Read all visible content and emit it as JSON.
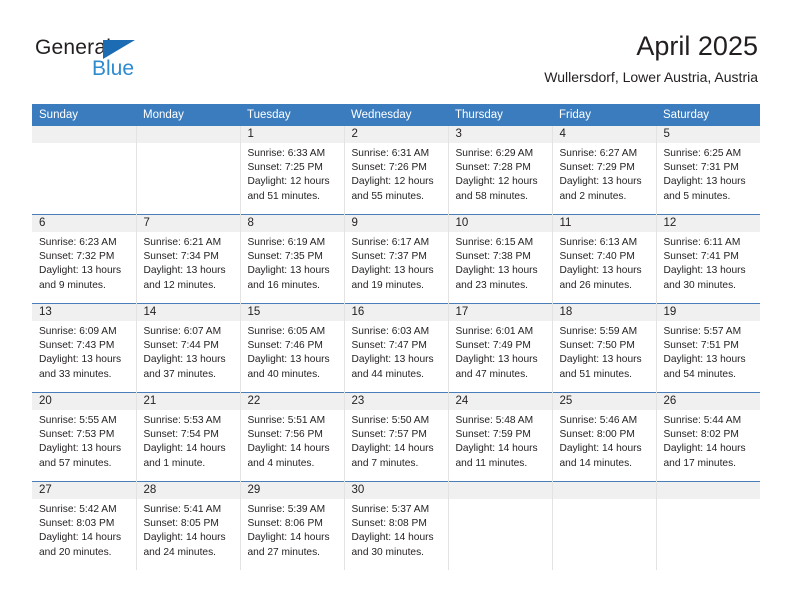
{
  "brand": {
    "name_part1": "General",
    "name_part2": "Blue",
    "triangle_icon": "triangle-icon"
  },
  "header": {
    "title": "April 2025",
    "subtitle": "Wullersdorf, Lower Austria, Austria"
  },
  "colors": {
    "header_blue": "#3b7cbe",
    "row_separator_blue": "#4a7ebb",
    "daynum_background": "#f0f0f0",
    "logo_blue": "#2e8bd0",
    "logo_dark": "#231f20",
    "cell_border": "#e3e3e3"
  },
  "weekday_headers": [
    "Sunday",
    "Monday",
    "Tuesday",
    "Wednesday",
    "Thursday",
    "Friday",
    "Saturday"
  ],
  "labels": {
    "sunrise": "Sunrise:",
    "sunset": "Sunset:",
    "daylight": "Daylight:"
  },
  "weeks": [
    [
      {
        "day": "",
        "empty": true
      },
      {
        "day": "",
        "empty": true
      },
      {
        "day": "1",
        "sunrise": "Sunrise: 6:33 AM",
        "sunset": "Sunset: 7:25 PM",
        "daylight": "Daylight: 12 hours and 51 minutes."
      },
      {
        "day": "2",
        "sunrise": "Sunrise: 6:31 AM",
        "sunset": "Sunset: 7:26 PM",
        "daylight": "Daylight: 12 hours and 55 minutes."
      },
      {
        "day": "3",
        "sunrise": "Sunrise: 6:29 AM",
        "sunset": "Sunset: 7:28 PM",
        "daylight": "Daylight: 12 hours and 58 minutes."
      },
      {
        "day": "4",
        "sunrise": "Sunrise: 6:27 AM",
        "sunset": "Sunset: 7:29 PM",
        "daylight": "Daylight: 13 hours and 2 minutes."
      },
      {
        "day": "5",
        "sunrise": "Sunrise: 6:25 AM",
        "sunset": "Sunset: 7:31 PM",
        "daylight": "Daylight: 13 hours and 5 minutes."
      }
    ],
    [
      {
        "day": "6",
        "sunrise": "Sunrise: 6:23 AM",
        "sunset": "Sunset: 7:32 PM",
        "daylight": "Daylight: 13 hours and 9 minutes."
      },
      {
        "day": "7",
        "sunrise": "Sunrise: 6:21 AM",
        "sunset": "Sunset: 7:34 PM",
        "daylight": "Daylight: 13 hours and 12 minutes."
      },
      {
        "day": "8",
        "sunrise": "Sunrise: 6:19 AM",
        "sunset": "Sunset: 7:35 PM",
        "daylight": "Daylight: 13 hours and 16 minutes."
      },
      {
        "day": "9",
        "sunrise": "Sunrise: 6:17 AM",
        "sunset": "Sunset: 7:37 PM",
        "daylight": "Daylight: 13 hours and 19 minutes."
      },
      {
        "day": "10",
        "sunrise": "Sunrise: 6:15 AM",
        "sunset": "Sunset: 7:38 PM",
        "daylight": "Daylight: 13 hours and 23 minutes."
      },
      {
        "day": "11",
        "sunrise": "Sunrise: 6:13 AM",
        "sunset": "Sunset: 7:40 PM",
        "daylight": "Daylight: 13 hours and 26 minutes."
      },
      {
        "day": "12",
        "sunrise": "Sunrise: 6:11 AM",
        "sunset": "Sunset: 7:41 PM",
        "daylight": "Daylight: 13 hours and 30 minutes."
      }
    ],
    [
      {
        "day": "13",
        "sunrise": "Sunrise: 6:09 AM",
        "sunset": "Sunset: 7:43 PM",
        "daylight": "Daylight: 13 hours and 33 minutes."
      },
      {
        "day": "14",
        "sunrise": "Sunrise: 6:07 AM",
        "sunset": "Sunset: 7:44 PM",
        "daylight": "Daylight: 13 hours and 37 minutes."
      },
      {
        "day": "15",
        "sunrise": "Sunrise: 6:05 AM",
        "sunset": "Sunset: 7:46 PM",
        "daylight": "Daylight: 13 hours and 40 minutes."
      },
      {
        "day": "16",
        "sunrise": "Sunrise: 6:03 AM",
        "sunset": "Sunset: 7:47 PM",
        "daylight": "Daylight: 13 hours and 44 minutes."
      },
      {
        "day": "17",
        "sunrise": "Sunrise: 6:01 AM",
        "sunset": "Sunset: 7:49 PM",
        "daylight": "Daylight: 13 hours and 47 minutes."
      },
      {
        "day": "18",
        "sunrise": "Sunrise: 5:59 AM",
        "sunset": "Sunset: 7:50 PM",
        "daylight": "Daylight: 13 hours and 51 minutes."
      },
      {
        "day": "19",
        "sunrise": "Sunrise: 5:57 AM",
        "sunset": "Sunset: 7:51 PM",
        "daylight": "Daylight: 13 hours and 54 minutes."
      }
    ],
    [
      {
        "day": "20",
        "sunrise": "Sunrise: 5:55 AM",
        "sunset": "Sunset: 7:53 PM",
        "daylight": "Daylight: 13 hours and 57 minutes."
      },
      {
        "day": "21",
        "sunrise": "Sunrise: 5:53 AM",
        "sunset": "Sunset: 7:54 PM",
        "daylight": "Daylight: 14 hours and 1 minute."
      },
      {
        "day": "22",
        "sunrise": "Sunrise: 5:51 AM",
        "sunset": "Sunset: 7:56 PM",
        "daylight": "Daylight: 14 hours and 4 minutes."
      },
      {
        "day": "23",
        "sunrise": "Sunrise: 5:50 AM",
        "sunset": "Sunset: 7:57 PM",
        "daylight": "Daylight: 14 hours and 7 minutes."
      },
      {
        "day": "24",
        "sunrise": "Sunrise: 5:48 AM",
        "sunset": "Sunset: 7:59 PM",
        "daylight": "Daylight: 14 hours and 11 minutes."
      },
      {
        "day": "25",
        "sunrise": "Sunrise: 5:46 AM",
        "sunset": "Sunset: 8:00 PM",
        "daylight": "Daylight: 14 hours and 14 minutes."
      },
      {
        "day": "26",
        "sunrise": "Sunrise: 5:44 AM",
        "sunset": "Sunset: 8:02 PM",
        "daylight": "Daylight: 14 hours and 17 minutes."
      }
    ],
    [
      {
        "day": "27",
        "sunrise": "Sunrise: 5:42 AM",
        "sunset": "Sunset: 8:03 PM",
        "daylight": "Daylight: 14 hours and 20 minutes."
      },
      {
        "day": "28",
        "sunrise": "Sunrise: 5:41 AM",
        "sunset": "Sunset: 8:05 PM",
        "daylight": "Daylight: 14 hours and 24 minutes."
      },
      {
        "day": "29",
        "sunrise": "Sunrise: 5:39 AM",
        "sunset": "Sunset: 8:06 PM",
        "daylight": "Daylight: 14 hours and 27 minutes."
      },
      {
        "day": "30",
        "sunrise": "Sunrise: 5:37 AM",
        "sunset": "Sunset: 8:08 PM",
        "daylight": "Daylight: 14 hours and 30 minutes."
      },
      {
        "day": "",
        "empty": true
      },
      {
        "day": "",
        "empty": true
      },
      {
        "day": "",
        "empty": true
      }
    ]
  ]
}
